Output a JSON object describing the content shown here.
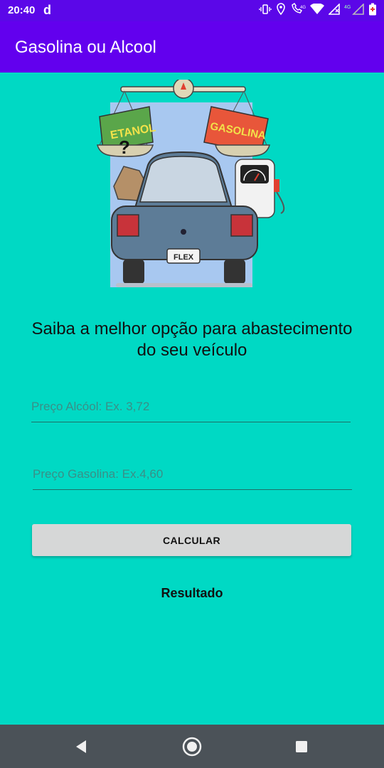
{
  "status_bar": {
    "time": "20:40",
    "app_glyph": "d",
    "icons": [
      "vibrate-icon",
      "location-icon",
      "wifi-calling-icon",
      "wifi-icon",
      "signal-icon",
      "signal-icon-2",
      "battery-icon"
    ],
    "network_label": "4G"
  },
  "app_bar": {
    "title": "Gasolina ou Alcool"
  },
  "illustration": {
    "left_sign": "ETANOL",
    "right_sign": "GASOLINA",
    "question_mark": "?",
    "plate": "FLEX"
  },
  "headline": "Saiba a melhor opção para abastecimento do seu veículo",
  "inputs": {
    "alcool": {
      "placeholder": "Preço Alcóol: Ex. 3,72",
      "value": ""
    },
    "gasolina": {
      "placeholder": "Preço Gasolina: Ex.4,60",
      "value": ""
    }
  },
  "button": {
    "label": "CALCULAR"
  },
  "result": {
    "label": "Resultado"
  },
  "nav": {
    "icons": [
      "back-icon",
      "home-icon",
      "recents-icon"
    ]
  },
  "colors": {
    "background": "#00d9c4",
    "app_bar": "#6200ee",
    "status_bar": "#5b07e8",
    "button": "#d6d7d7"
  }
}
